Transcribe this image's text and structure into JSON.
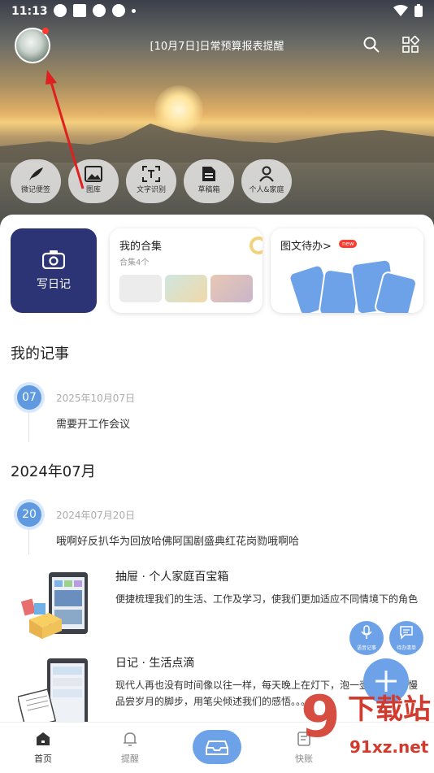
{
  "status_bar": {
    "time": "11:13"
  },
  "header": {
    "reminder": "[10月7日]日常预算报表提醒"
  },
  "quick_actions": [
    {
      "label": "微记便签",
      "icon": "feather-icon"
    },
    {
      "label": "图库",
      "icon": "image-icon"
    },
    {
      "label": "文字识别",
      "icon": "text-scan-icon"
    },
    {
      "label": "草稿箱",
      "icon": "drafts-icon"
    },
    {
      "label": "个人&家庭",
      "icon": "person-icon"
    }
  ],
  "write_diary": {
    "label": "写日记"
  },
  "collections": {
    "title": "我的合集",
    "count": "合集4个"
  },
  "todo": {
    "title": "图文待办>",
    "badge": "new"
  },
  "my_notes": {
    "title": "我的记事",
    "day": "07",
    "date": "2025年10月07日",
    "text": "需要开工作会议"
  },
  "month_group": {
    "title": "2024年07月",
    "day": "20",
    "date": "2024年07月20日",
    "text": "哦啊好反扒华为回放哈佛阿国剧盛典红花岗勠哦啊哈"
  },
  "articles": [
    {
      "title": "抽屉 · 个人家庭百宝箱",
      "desc": "便捷梳理我们的生活、工作及学习，使我们更加适应不同情境下的角色"
    },
    {
      "title": "日记 · 生活点滴",
      "desc": "现代人再也没有时间像以往一样，每天晚上在灯下，泡一壶清茶，慢慢品尝岁月的脚步，用笔尖倾述我们的感悟。。。"
    }
  ],
  "fabs": {
    "voice": "语音记事",
    "todo": "待办清单"
  },
  "nav": {
    "home": "首页",
    "remind": "提醒",
    "kuaiji": "快账"
  },
  "watermark": {
    "big": "下载站",
    "url": "91xz.net"
  },
  "colors": {
    "accent": "#6ea2e8",
    "navy": "#2d3475",
    "badge": "#ff3b30"
  }
}
